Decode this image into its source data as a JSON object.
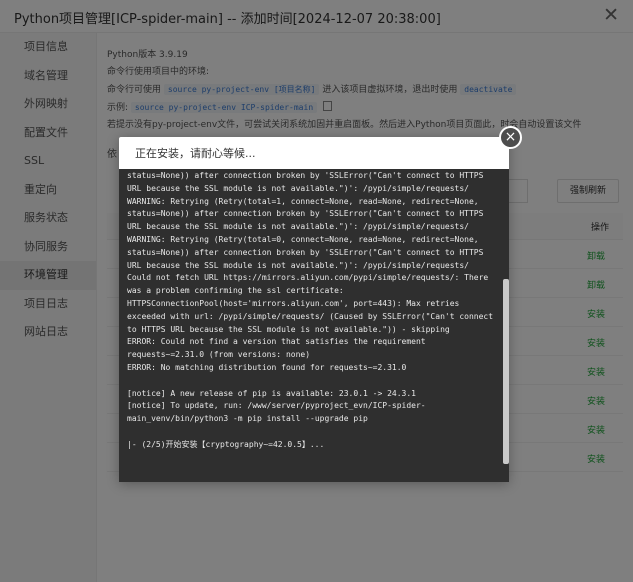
{
  "dialog": {
    "title": "Python项目管理[ICP-spider-main] -- 添加时间[2024-12-07 20:38:00]",
    "close_glyph": "✕"
  },
  "sidebar": {
    "items": [
      {
        "label": "项目信息"
      },
      {
        "label": "域名管理"
      },
      {
        "label": "外网映射"
      },
      {
        "label": "配置文件"
      },
      {
        "label": "SSL"
      },
      {
        "label": "重定向"
      },
      {
        "label": "服务状态"
      },
      {
        "label": "协同服务"
      },
      {
        "label": "环境管理"
      },
      {
        "label": "项目日志"
      },
      {
        "label": "网站日志"
      }
    ],
    "active_index": 8
  },
  "main": {
    "python_version": "Python版本 3.9.19",
    "cmd_intro": "命令行使用项目中的环境:",
    "cmd_prefix": "命令行可使用",
    "cmd_code": "source py-project-env [项目名称]",
    "cmd_mid": "进入该项目虚拟环境，退出时使用",
    "cmd_deactivate": "deactivate",
    "example_label": "示例:",
    "example_code": "source py-project-env ICP-spider-main",
    "hint": "若提示没有py-project-env文件，可尝试关闭系统加固并重启面板。然后进入Python项目页面此，时会自动设置该文件",
    "deps_label": "依",
    "refresh_label": "强制刷新",
    "op_header": "操作",
    "row_actions": [
      "卸载",
      "卸载",
      "安装",
      "安装",
      "安装",
      "安装",
      "安装",
      "安装"
    ]
  },
  "modal": {
    "title": "正在安装，请耐心等候...",
    "close_glyph": "×",
    "log_lines": [
      "status=None)) after connection broken by 'SSLError(\"Can't connect to HTTPS URL because the SSL module is not available.\")': /pypi/simple/requests/",
      "WARNING: Retrying (Retry(total=1, connect=None, read=None, redirect=None, status=None)) after connection broken by 'SSLError(\"Can't connect to HTTPS URL because the SSL module is not available.\")': /pypi/simple/requests/",
      "WARNING: Retrying (Retry(total=0, connect=None, read=None, redirect=None, status=None)) after connection broken by 'SSLError(\"Can't connect to HTTPS URL because the SSL module is not available.\")': /pypi/simple/requests/",
      "Could not fetch URL https://mirrors.aliyun.com/pypi/simple/requests/: There was a problem confirming the ssl certificate: HTTPSConnectionPool(host='mirrors.aliyun.com', port=443): Max retries exceeded with url: /pypi/simple/requests/ (Caused by SSLError(\"Can't connect to HTTPS URL because the SSL module is not available.\")) - skipping",
      "ERROR: Could not find a version that satisfies the requirement requests~=2.31.0 (from versions: none)",
      "ERROR: No matching distribution found for requests~=2.31.0",
      "",
      "[notice] A new release of pip is available: 23.0.1 -> 24.3.1",
      "[notice] To update, run: /www/server/pyproject_evn/ICP-spider-main_venv/bin/python3 -m pip install --upgrade pip",
      "",
      "|- (2/5)开始安装【cryptography~=42.0.5】..."
    ]
  },
  "colors": {
    "accent_green": "#20a53a",
    "terminal_bg": "#2f2f2f",
    "overlay": "rgba(0,0,0,0.5)"
  }
}
